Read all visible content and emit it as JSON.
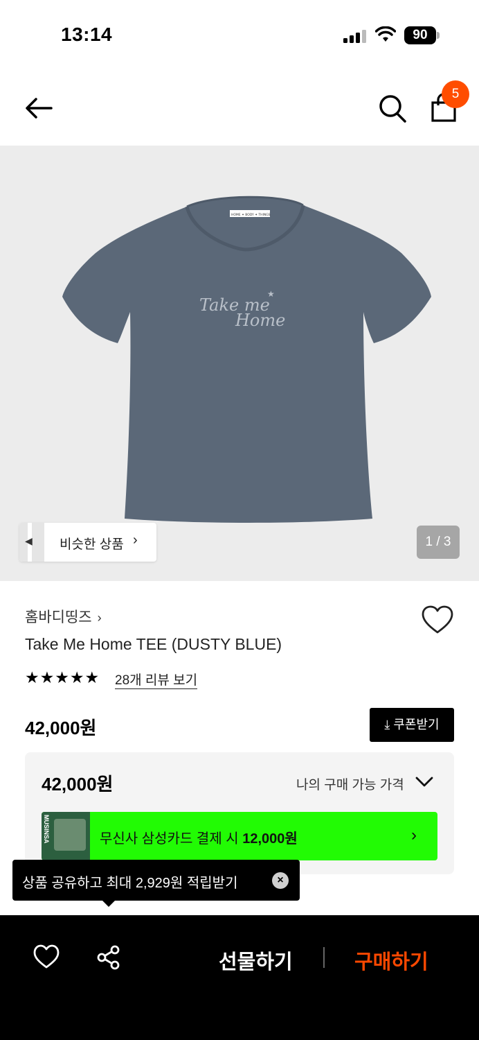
{
  "status_bar": {
    "time": "13:14",
    "battery": "90"
  },
  "header": {
    "cart_count": "5"
  },
  "gallery": {
    "similar_label": "비슷한 상품",
    "page_counter": "1 / 3",
    "print_line1": "Take me",
    "print_line2": "Home",
    "neck_label": "HOME ✦ BODY ✦ THINGS"
  },
  "product": {
    "brand": "홈바디띵즈",
    "name": "Take Me Home TEE (DUSTY BLUE)",
    "stars": "★★★★★",
    "review_link": "28개 리뷰 보기",
    "price": "42,000원",
    "coupon_label": "쿠폰받기"
  },
  "price_box": {
    "amount": "42,000원",
    "toggle_label": "나의 구매 가능 가격",
    "card_thumb_text": "MUSINSA",
    "card_text_prefix": "무신사 삼성카드 결제 시 ",
    "card_text_amount": "12,000원"
  },
  "tooltip": {
    "text": "상품 공유하고 최대 2,929원 적립받기"
  },
  "bottom_bar": {
    "gift_label": "선물하기",
    "buy_label": "구매하기"
  },
  "colors": {
    "accent_orange": "#ff4800",
    "card_green": "#22fb04",
    "shirt": "#5b6878",
    "gallery_bg": "#ececec"
  }
}
